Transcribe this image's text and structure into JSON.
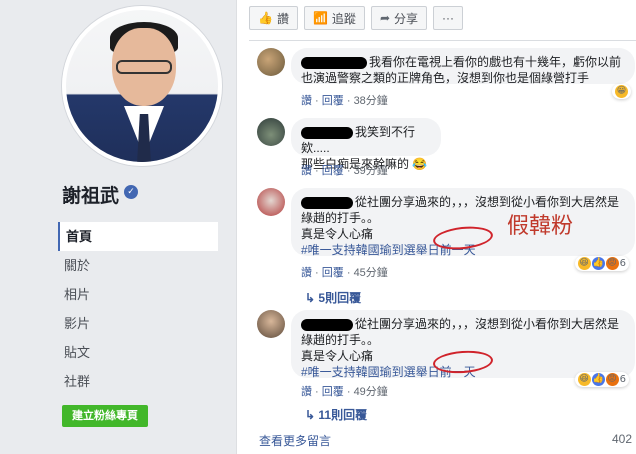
{
  "profile": {
    "name": "謝祖武",
    "nav": [
      "首頁",
      "關於",
      "相片",
      "影片",
      "貼文",
      "社群"
    ],
    "create_button": "建立粉絲專頁"
  },
  "post_actions": {
    "like": "讚",
    "follow": "追蹤",
    "share": "分享",
    "more": "···"
  },
  "comments": [
    {
      "line1": "我看你在電視上看你的戲也有十幾年，虧你以前",
      "line2": "也演過警察之類的正牌角色，沒想到你也是個綠營打手",
      "emoji": "😀",
      "like": "讚",
      "reply": "回覆",
      "time": "38分鐘"
    },
    {
      "line1": "我笑到不行欸.....",
      "line2": "那些白痴是來幹嘛的 😂",
      "like": "讚",
      "reply": "回覆",
      "time": "39分鐘"
    },
    {
      "line1": "從社團分享過來的，，，沒想到從小看你到大居然是",
      "line2": "綠趙的打手。。",
      "line3": "真是令人心痛",
      "line4": "#唯一支持韓國瑜到選舉日前一天",
      "like": "讚",
      "reply": "回覆",
      "time": "45分鐘",
      "reaction_count": "6",
      "replies": "5則回覆"
    },
    {
      "line1": "從社團分享過來的，，，沒想到從小看你到大居然是",
      "line2": "綠趙的打手。。",
      "line3": "真是令人心痛",
      "line4": "#唯一支持韓國瑜到選舉日前一天",
      "like": "讚",
      "reply": "回覆",
      "time": "49分鐘",
      "reaction_count": "6",
      "replies": "11則回覆"
    }
  ],
  "annotation": "假韓粉",
  "footer": {
    "see_more": "查看更多留言",
    "count": "402"
  },
  "colors": {
    "link": "#385898",
    "green_button": "#42b72a",
    "annotation_red": "#d0232b"
  }
}
